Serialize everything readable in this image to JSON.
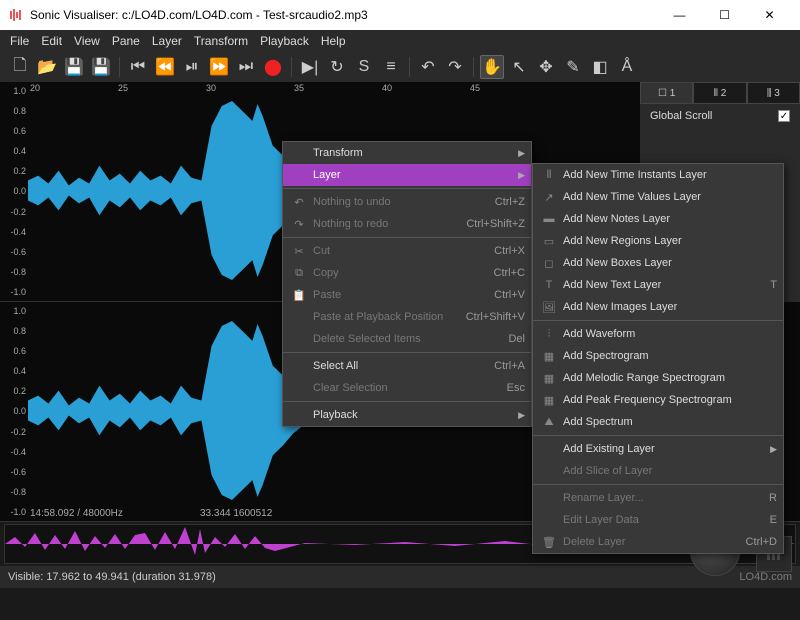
{
  "window": {
    "title": "Sonic Visualiser: c:/LO4D.com/LO4D.com - Test-srcaudio2.mp3"
  },
  "menu": {
    "items": [
      "File",
      "Edit",
      "View",
      "Pane",
      "Layer",
      "Transform",
      "Playback",
      "Help"
    ]
  },
  "yaxis": [
    "1.0",
    "0.8",
    "0.6",
    "0.4",
    "0.2",
    "0.0",
    "-0.2",
    "-0.4",
    "-0.6",
    "-0.8",
    "-1.0"
  ],
  "xaxis": [
    {
      "t": "20",
      "p": 2
    },
    {
      "t": "25",
      "p": 90
    },
    {
      "t": "30",
      "p": 178
    },
    {
      "t": "35",
      "p": 266
    },
    {
      "t": "40",
      "p": 354
    },
    {
      "t": "45",
      "p": 442
    }
  ],
  "paneinfo": {
    "left": "14:58.092 / 48000Hz",
    "center": "33.344  1600512"
  },
  "side": {
    "tabs": [
      "☐ 1",
      "⫴ 2",
      "⫼ 3"
    ],
    "opt1": "Global Scroll"
  },
  "context1": {
    "items": [
      {
        "label": "Transform",
        "arrow": true
      },
      {
        "label": "Layer",
        "arrow": true,
        "hl": true
      },
      {
        "hr": true
      },
      {
        "label": "Nothing to undo",
        "shortcut": "Ctrl+Z",
        "dis": true,
        "icon": "↶"
      },
      {
        "label": "Nothing to redo",
        "shortcut": "Ctrl+Shift+Z",
        "dis": true,
        "icon": "↷"
      },
      {
        "hr": true
      },
      {
        "label": "Cut",
        "shortcut": "Ctrl+X",
        "dis": true,
        "icon": "✂"
      },
      {
        "label": "Copy",
        "shortcut": "Ctrl+C",
        "dis": true,
        "icon": "⧉"
      },
      {
        "label": "Paste",
        "shortcut": "Ctrl+V",
        "dis": true,
        "icon": "📋"
      },
      {
        "label": "Paste at Playback Position",
        "shortcut": "Ctrl+Shift+V",
        "dis": true
      },
      {
        "label": "Delete Selected Items",
        "shortcut": "Del",
        "dis": true
      },
      {
        "hr": true
      },
      {
        "label": "Select All",
        "shortcut": "Ctrl+A"
      },
      {
        "label": "Clear Selection",
        "shortcut": "Esc",
        "dis": true
      },
      {
        "hr": true
      },
      {
        "label": "Playback",
        "arrow": true
      }
    ]
  },
  "context2": {
    "items": [
      {
        "label": "Add New Time Instants Layer",
        "icon": "⦀"
      },
      {
        "label": "Add New Time Values Layer",
        "icon": "↗"
      },
      {
        "label": "Add New Notes Layer",
        "icon": "▬"
      },
      {
        "label": "Add New Regions Layer",
        "icon": "▭"
      },
      {
        "label": "Add New Boxes Layer",
        "icon": "◻"
      },
      {
        "label": "Add New Text Layer",
        "shortcut": "T",
        "icon": "T"
      },
      {
        "label": "Add New Images Layer",
        "icon": "🖼"
      },
      {
        "hr": true
      },
      {
        "label": "Add Waveform",
        "icon": "⫶"
      },
      {
        "label": "Add Spectrogram",
        "icon": "▦"
      },
      {
        "label": "Add Melodic Range Spectrogram",
        "icon": "▦"
      },
      {
        "label": "Add Peak Frequency Spectrogram",
        "icon": "▦"
      },
      {
        "label": "Add Spectrum",
        "icon": "⛰"
      },
      {
        "hr": true
      },
      {
        "label": "Add Existing Layer",
        "arrow": true
      },
      {
        "label": "Add Slice of Layer",
        "dis": true
      },
      {
        "hr": true
      },
      {
        "label": "Rename Layer...",
        "shortcut": "R",
        "dis": true
      },
      {
        "label": "Edit Layer Data",
        "shortcut": "E",
        "dis": true
      },
      {
        "label": "Delete Layer",
        "shortcut": "Ctrl+D",
        "dis": true,
        "icon": "🗑"
      }
    ]
  },
  "status": {
    "left": "Visible: 17.962 to 49.941 (duration 31.978)",
    "right": "LO4D.com"
  }
}
